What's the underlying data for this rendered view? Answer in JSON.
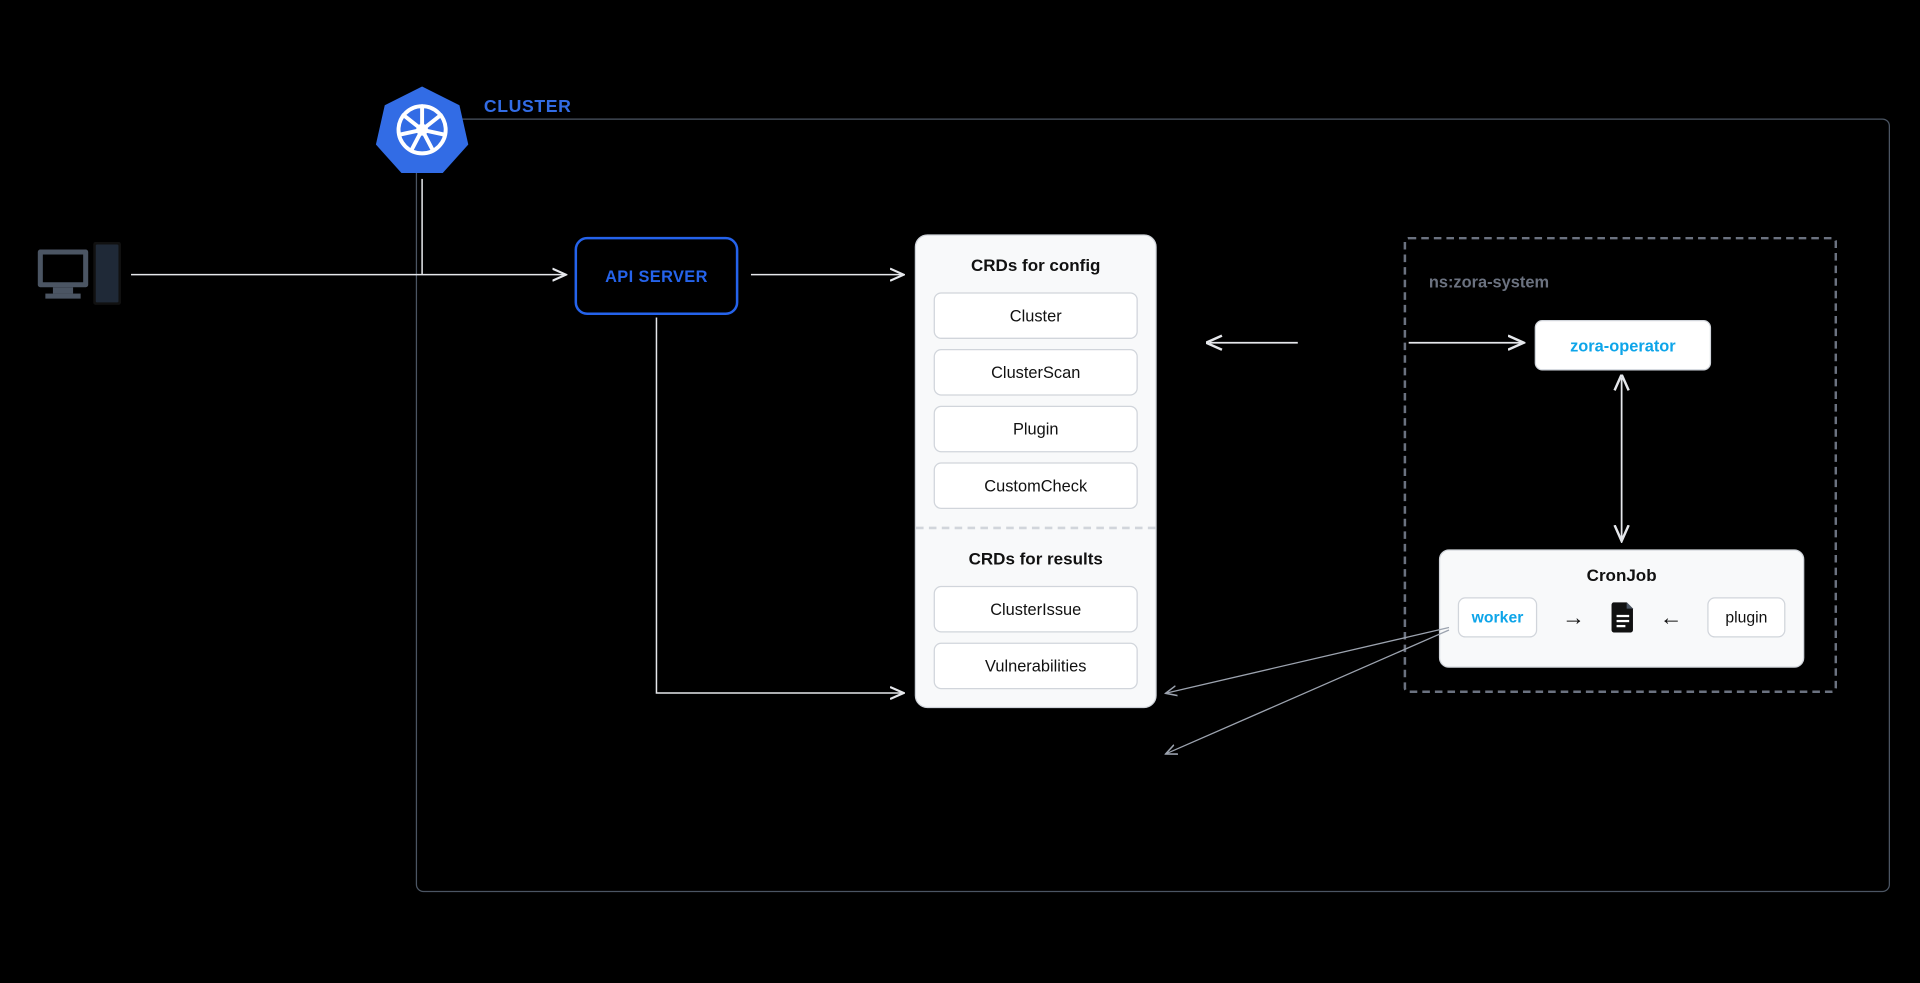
{
  "cluster": {
    "label": "CLUSTER"
  },
  "api_server": {
    "label": "API SERVER"
  },
  "crds": {
    "config_heading": "CRDs for config",
    "config_items": [
      "Cluster",
      "ClusterScan",
      "Plugin",
      "CustomCheck"
    ],
    "results_heading": "CRDs for results",
    "results_items": [
      "ClusterIssue",
      "Vulnerabilities"
    ]
  },
  "namespace": {
    "label": "ns:zora-system",
    "operator": "zora-operator"
  },
  "cronjob": {
    "title": "CronJob",
    "worker": "worker",
    "plugin": "plugin"
  },
  "colors": {
    "blue": "#2563eb",
    "k8s_blue": "#326CE5",
    "cyan": "#0ea5e9",
    "gray": "#6b7280"
  }
}
